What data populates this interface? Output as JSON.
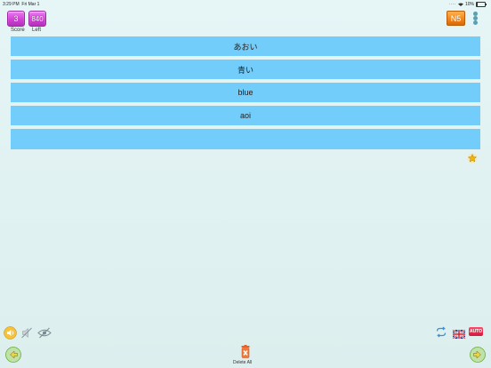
{
  "status": {
    "time": "3:29 PM",
    "date": "Fri Mar 1",
    "battery": "10%",
    "battery_level": 0.1
  },
  "counters": {
    "score_value": "3",
    "score_label": "Score",
    "left_value": "840",
    "left_label": "Left"
  },
  "level": "N5",
  "rows": [
    "あおい",
    "青い",
    "blue",
    "aoi",
    ""
  ],
  "bottom": {
    "delete_all_label": "Delete All",
    "auto_label": "AUTO"
  },
  "colors": {
    "row": "#72cdfb",
    "badge": "#d242d8",
    "level": "#f0831a",
    "auto": "#d01a3e"
  }
}
